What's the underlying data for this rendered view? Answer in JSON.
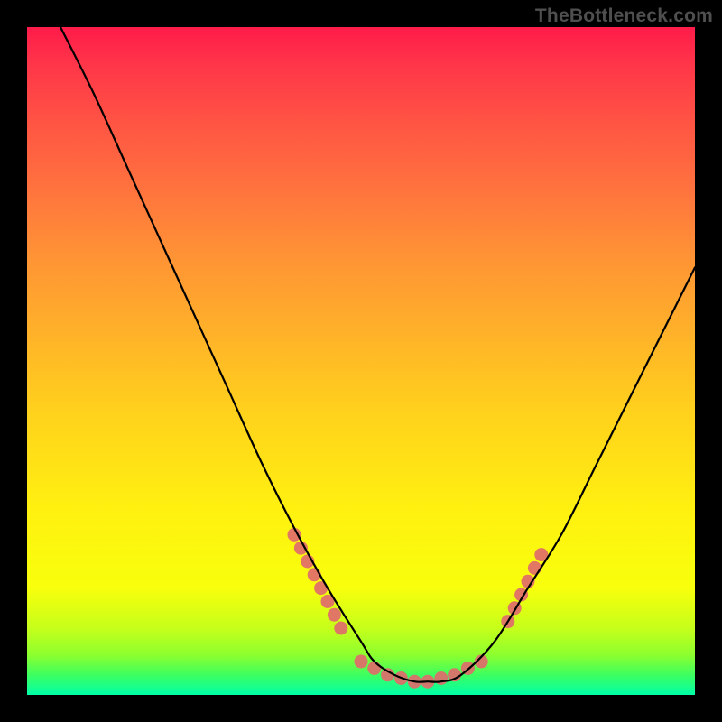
{
  "watermark": "TheBottleneck.com",
  "chart_data": {
    "type": "line",
    "title": "",
    "xlabel": "",
    "ylabel": "",
    "xlim": [
      0,
      100
    ],
    "ylim": [
      0,
      100
    ],
    "grid": false,
    "series": [
      {
        "name": "curve",
        "color": "#000000",
        "x": [
          5,
          10,
          15,
          20,
          25,
          30,
          35,
          40,
          45,
          50,
          52,
          55,
          58,
          60,
          62,
          65,
          70,
          75,
          80,
          85,
          90,
          95,
          100
        ],
        "y": [
          100,
          90,
          79,
          68,
          57,
          46,
          35,
          25,
          16,
          8,
          5,
          3,
          2,
          2,
          2,
          3,
          8,
          16,
          24,
          34,
          44,
          54,
          64
        ]
      }
    ],
    "markers": [
      {
        "name": "left-cluster",
        "color": "#e06b6b",
        "x": [
          40,
          41,
          42,
          43,
          44,
          45,
          46,
          47
        ],
        "y": [
          24,
          22,
          20,
          18,
          16,
          14,
          12,
          10
        ]
      },
      {
        "name": "bottom-cluster",
        "color": "#e06b6b",
        "x": [
          50,
          52,
          54,
          56,
          58,
          60,
          62,
          64,
          66,
          68
        ],
        "y": [
          5,
          4,
          3,
          2.5,
          2,
          2,
          2.5,
          3,
          4,
          5
        ]
      },
      {
        "name": "right-cluster",
        "color": "#e06b6b",
        "x": [
          72,
          73,
          74,
          75,
          76,
          77
        ],
        "y": [
          11,
          13,
          15,
          17,
          19,
          21
        ]
      }
    ],
    "gradient_stops": [
      {
        "pos": 0,
        "color": "#ff1b49"
      },
      {
        "pos": 6,
        "color": "#ff3749"
      },
      {
        "pos": 14,
        "color": "#ff5344"
      },
      {
        "pos": 24,
        "color": "#ff723e"
      },
      {
        "pos": 34,
        "color": "#ff9235"
      },
      {
        "pos": 46,
        "color": "#ffb229"
      },
      {
        "pos": 58,
        "color": "#ffd21c"
      },
      {
        "pos": 72,
        "color": "#fff010"
      },
      {
        "pos": 84,
        "color": "#f8ff0c"
      },
      {
        "pos": 90,
        "color": "#c6ff1a"
      },
      {
        "pos": 94,
        "color": "#8dff2e"
      },
      {
        "pos": 97,
        "color": "#3dff60"
      },
      {
        "pos": 100,
        "color": "#00ffa8"
      }
    ]
  }
}
